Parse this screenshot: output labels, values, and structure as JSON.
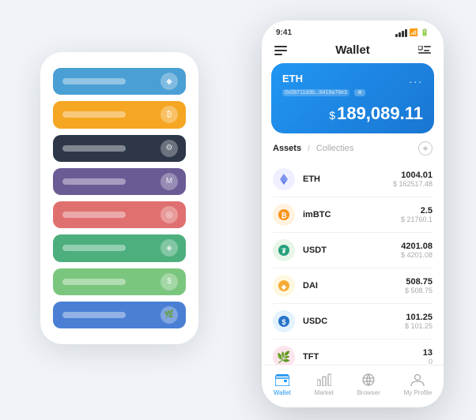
{
  "scene": {
    "bg_phone": {
      "cards": [
        {
          "color": "card-blue",
          "label": ""
        },
        {
          "color": "card-orange",
          "label": ""
        },
        {
          "color": "card-dark",
          "label": ""
        },
        {
          "color": "card-purple",
          "label": ""
        },
        {
          "color": "card-red",
          "label": ""
        },
        {
          "color": "card-green",
          "label": ""
        },
        {
          "color": "card-light-green",
          "label": ""
        },
        {
          "color": "card-royal-blue",
          "label": ""
        }
      ]
    },
    "main_phone": {
      "status_bar": {
        "time": "9:41"
      },
      "header": {
        "title": "Wallet",
        "menu_icon": "≡",
        "expand_icon": "⇔"
      },
      "eth_card": {
        "symbol": "ETH",
        "address": "0x08711d3b...8418a78e3",
        "address_badge": "⊕",
        "dots": "...",
        "dollar_sign": "$",
        "amount": "189,089.11"
      },
      "assets": {
        "tab_active": "Assets",
        "separator": "/",
        "tab_inactive": "Collecties",
        "add_button": "+"
      },
      "asset_list": [
        {
          "name": "ETH",
          "icon_color": "#627EEA",
          "icon_text": "♦",
          "amount": "1004.01",
          "usd": "$ 162517.48"
        },
        {
          "name": "imBTC",
          "icon_color": "#F7931A",
          "icon_text": "₿",
          "amount": "2.5",
          "usd": "$ 21760.1"
        },
        {
          "name": "USDT",
          "icon_color": "#26A17B",
          "icon_text": "₮",
          "amount": "4201.08",
          "usd": "$ 4201.08"
        },
        {
          "name": "DAI",
          "icon_color": "#F5AC37",
          "icon_text": "◈",
          "amount": "508.75",
          "usd": "$ 508.75"
        },
        {
          "name": "USDC",
          "icon_color": "#2775CA",
          "icon_text": "$",
          "amount": "101.25",
          "usd": "$ 101.25"
        },
        {
          "name": "TFT",
          "icon_color": "#E74C3C",
          "icon_text": "🌿",
          "amount": "13",
          "usd": "0"
        }
      ],
      "bottom_nav": [
        {
          "label": "Wallet",
          "active": true,
          "icon": "wallet"
        },
        {
          "label": "Market",
          "active": false,
          "icon": "chart"
        },
        {
          "label": "Browser",
          "active": false,
          "icon": "browser"
        },
        {
          "label": "My Profile",
          "active": false,
          "icon": "profile"
        }
      ]
    }
  }
}
